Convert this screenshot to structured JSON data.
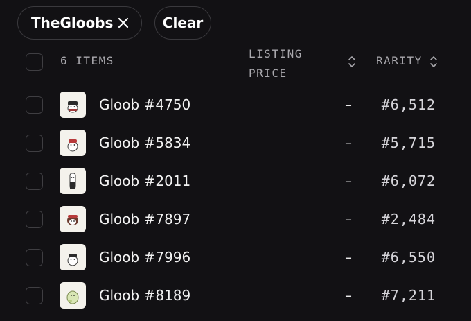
{
  "filters": {
    "collection_chip_label": "TheGloobs",
    "clear_label": "Clear"
  },
  "header": {
    "items_count_label": "6 ITEMS",
    "listing_price_line1": "LISTING",
    "listing_price_line2": "PRICE",
    "rarity_label": "RARITY"
  },
  "items": [
    {
      "name": "Gloob #4750",
      "price": "–",
      "rarity": "#6,512",
      "thumb_icon": "gloob-black-hat"
    },
    {
      "name": "Gloob #5834",
      "price": "–",
      "rarity": "#5,715",
      "thumb_icon": "gloob-red-cap"
    },
    {
      "name": "Gloob #2011",
      "price": "–",
      "rarity": "#6,072",
      "thumb_icon": "gloob-tall-black"
    },
    {
      "name": "Gloob #7897",
      "price": "–",
      "rarity": "#2,484",
      "thumb_icon": "gloob-red-brown"
    },
    {
      "name": "Gloob #7996",
      "price": "–",
      "rarity": "#6,550",
      "thumb_icon": "gloob-black-cap"
    },
    {
      "name": "Gloob #8189",
      "price": "–",
      "rarity": "#7,211",
      "thumb_icon": "gloob-green"
    }
  ]
}
